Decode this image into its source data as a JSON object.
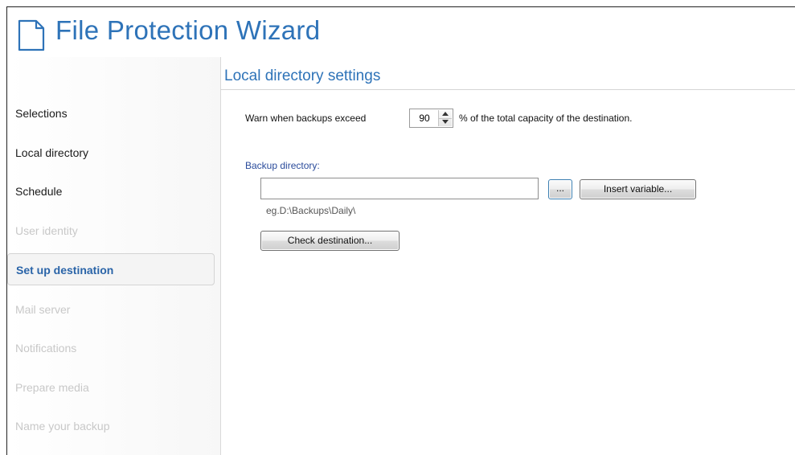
{
  "header": {
    "title": "File Protection Wizard",
    "icon": "document-icon"
  },
  "sidebar": {
    "items": [
      {
        "label": "Selections",
        "state": "normal"
      },
      {
        "label": "Local directory",
        "state": "normal"
      },
      {
        "label": "Schedule",
        "state": "normal"
      },
      {
        "label": "User identity",
        "state": "disabled"
      },
      {
        "label": "Set up destination",
        "state": "active"
      },
      {
        "label": "Mail server",
        "state": "disabled"
      },
      {
        "label": "Notifications",
        "state": "disabled"
      },
      {
        "label": "Prepare media",
        "state": "disabled"
      },
      {
        "label": "Name your backup",
        "state": "disabled"
      }
    ]
  },
  "main": {
    "section_title": "Local directory settings",
    "warn": {
      "prefix": "Warn when backups exceed",
      "value": "90",
      "suffix": "% of the total capacity of the destination."
    },
    "backup_directory": {
      "label": "Backup directory:",
      "value": "",
      "browse_label": "...",
      "insert_variable_label": "Insert variable...",
      "hint": "eg.D:\\Backups\\Daily\\"
    },
    "check_destination_label": "Check destination..."
  },
  "colors": {
    "title": "#2e73b8",
    "active_nav": "#2a64a8",
    "disabled_nav": "#c8c8c8",
    "label_blue": "#2a4b9b"
  }
}
